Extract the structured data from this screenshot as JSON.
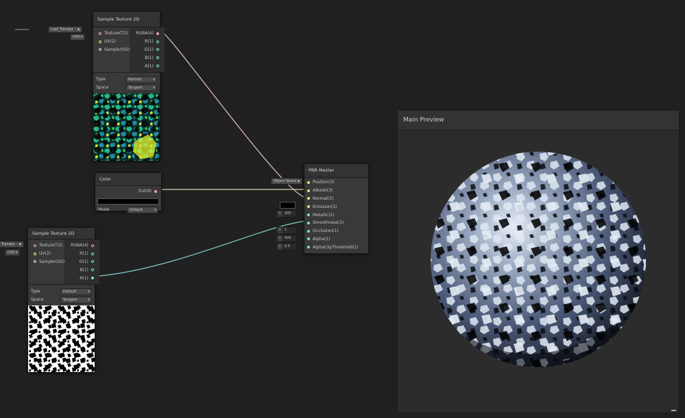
{
  "nodes": {
    "sample_texture_top": {
      "title": "Sample Texture 2D",
      "inputs": [
        "Texture(T2)",
        "UV(2)",
        "Sampler(SS)"
      ],
      "outputs": [
        "RGBA(4)",
        "R(1)",
        "G(1)",
        "B(1)",
        "A(1)"
      ],
      "type_label": "Type",
      "type_value": "Normal",
      "space_label": "Space",
      "space_value": "Tangent",
      "ext_texture": "Leaf_Transpa",
      "ext_uv": "UV0"
    },
    "color": {
      "title": "Color",
      "output": "Out(4)",
      "mode_label": "Mode",
      "mode_value": "Default",
      "swatch": "#000000"
    },
    "sample_texture_bottom": {
      "title": "Sample Texture 2D",
      "inputs": [
        "Texture(T2)",
        "UV(2)",
        "Sampler(SS)"
      ],
      "outputs": [
        "RGBA(4)",
        "R(1)",
        "G(1)",
        "B(1)",
        "A(1)"
      ],
      "type_label": "Type",
      "type_value": "Default",
      "space_label": "Space",
      "space_value": "Tangent",
      "ext_texture": "Transpa",
      "ext_uv": "UV0"
    },
    "pbr_master": {
      "title": "PBR Master",
      "inputs": [
        "Position(3)",
        "Albedo(3)",
        "Normal(3)",
        "Emission(3)",
        "Metallic(1)",
        "Smoothness(1)",
        "Occlusion(1)",
        "Alpha(1)",
        "AlphaClipThreshold(1)"
      ],
      "ext_position": "Object Space",
      "x_label": "X",
      "metallic_value": "205",
      "occlusion_value": "1",
      "alpha_value": "505",
      "alpha_clip_value": "0.5",
      "emission_swatch": "#000000"
    }
  },
  "preview": {
    "title": "Main Preview"
  },
  "colors": {
    "background": "#202020",
    "node": "#393939",
    "wire_pink": "#e8a0c8",
    "wire_yellow": "#d8d8a0",
    "wire_cyan": "#7ecfc8"
  }
}
